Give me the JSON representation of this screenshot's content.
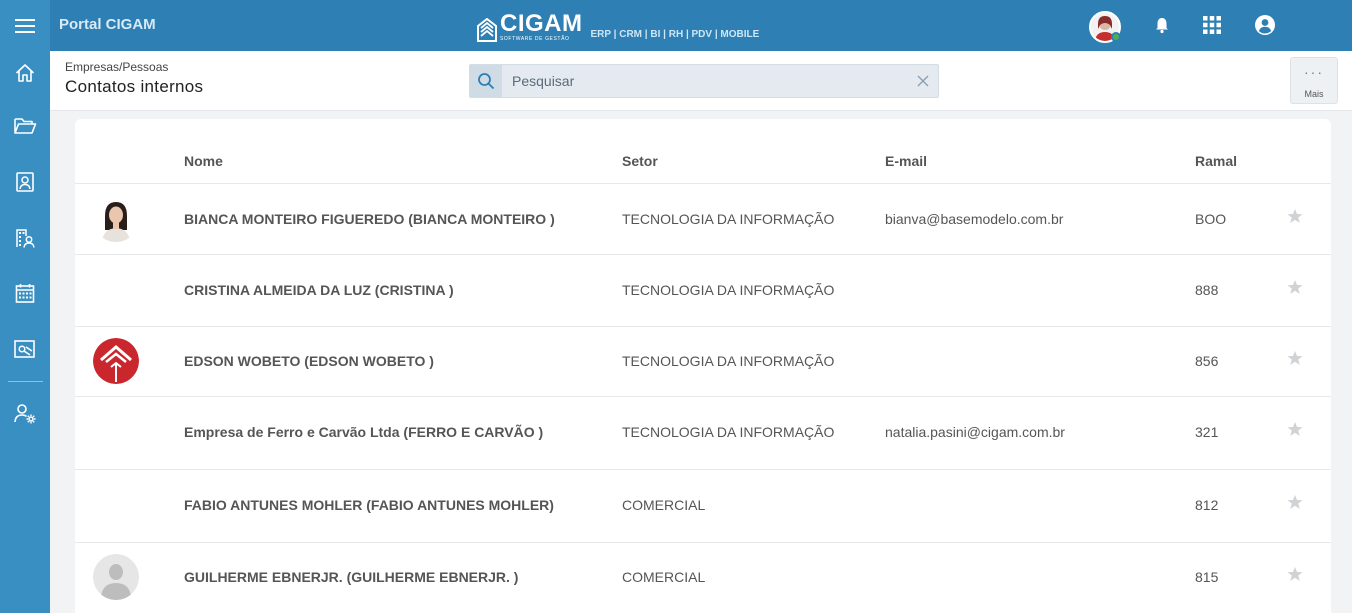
{
  "topbar": {
    "title": "Portal CIGAM",
    "logo_word": "CIGAM",
    "logo_sub": "SOFTWARE DE GESTÃO",
    "modules": "ERP | CRM | BI | RH | PDV | MOBILE"
  },
  "colors": {
    "topbar": "#2e7fb3",
    "sidebar": "#3a8fc2",
    "online": "#4caf50"
  },
  "sidebar": {
    "items": [
      {
        "icon": "home-icon"
      },
      {
        "icon": "folder-icon"
      },
      {
        "icon": "contact-card-icon"
      },
      {
        "icon": "building-person-icon"
      },
      {
        "icon": "calendar-icon"
      },
      {
        "icon": "money-icon"
      },
      {
        "icon": "user-settings-icon"
      }
    ]
  },
  "header": {
    "breadcrumb": "Empresas/Pessoas",
    "title": "Contatos internos",
    "search_placeholder": "Pesquisar",
    "more_label": "Mais",
    "more_dots": "···"
  },
  "table": {
    "columns": [
      "Nome",
      "Setor",
      "E-mail",
      "Ramal"
    ],
    "rows": [
      {
        "name": "BIANCA MONTEIRO FIGUEREDO (BIANCA MONTEIRO )",
        "setor": "TECNOLOGIA DA INFORMAÇÃO",
        "email": "bianva@basemodelo.com.br",
        "ramal": "BOO",
        "avatar": "photo-woman"
      },
      {
        "name": "CRISTINA ALMEIDA DA LUZ (CRISTINA )",
        "setor": "TECNOLOGIA DA INFORMAÇÃO",
        "email": "",
        "ramal": "888",
        "avatar": "none"
      },
      {
        "name": "EDSON WOBETO (EDSON WOBETO )",
        "setor": "TECNOLOGIA DA INFORMAÇÃO",
        "email": "",
        "ramal": "856",
        "avatar": "logo-red"
      },
      {
        "name": "Empresa de Ferro e Carvão Ltda (FERRO E CARVÃO )",
        "setor": "TECNOLOGIA DA INFORMAÇÃO",
        "email": "natalia.pasini@cigam.com.br",
        "ramal": "321",
        "avatar": "none"
      },
      {
        "name": "FABIO ANTUNES MOHLER (FABIO ANTUNES MOHLER)",
        "setor": "COMERCIAL",
        "email": "",
        "ramal": "812",
        "avatar": "none"
      },
      {
        "name": "GUILHERME EBNERJR. (GUILHERME EBNERJR. )",
        "setor": "COMERCIAL",
        "email": "",
        "ramal": "815",
        "avatar": "silhouette"
      }
    ]
  }
}
